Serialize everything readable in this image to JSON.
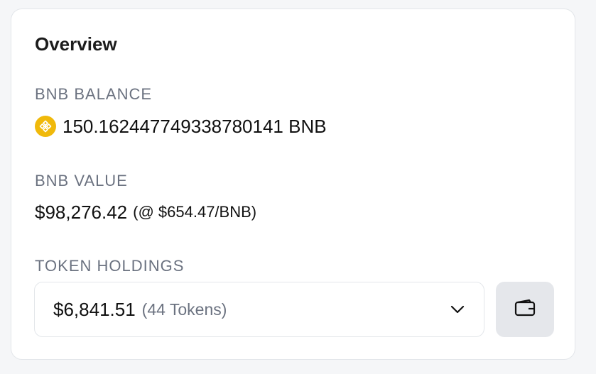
{
  "overview": {
    "title": "Overview",
    "balance": {
      "label": "BNB BALANCE",
      "amount": "150.162447749338780141 BNB",
      "icon": "bnb-coin-icon",
      "icon_color": "#f0b90b"
    },
    "value": {
      "label": "BNB VALUE",
      "amount": "$98,276.42",
      "price_note": "(@ $654.47/BNB)"
    },
    "tokens": {
      "label": "TOKEN HOLDINGS",
      "amount": "$6,841.51",
      "count": "(44 Tokens)",
      "dropdown_icon": "chevron-down-icon",
      "wallet_icon": "wallet-icon"
    }
  },
  "colors": {
    "page_background": "#f5f6f8",
    "card_background": "#ffffff",
    "label_text": "#6b7280",
    "button_background": "#e5e7eb"
  }
}
